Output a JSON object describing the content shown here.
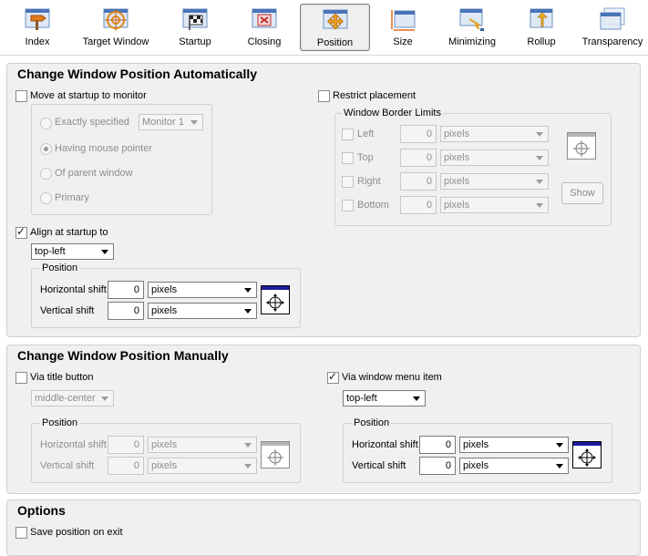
{
  "toolbar": {
    "items": [
      {
        "label": "Index"
      },
      {
        "label": "Target Window"
      },
      {
        "label": "Startup"
      },
      {
        "label": "Closing"
      },
      {
        "label": "Position"
      },
      {
        "label": "Size"
      },
      {
        "label": "Minimizing"
      },
      {
        "label": "Rollup"
      },
      {
        "label": "Transparency"
      }
    ]
  },
  "auto": {
    "title": "Change Window Position Automatically",
    "move_monitor": {
      "label": "Move at startup to monitor",
      "checked": false
    },
    "exactly": {
      "label": "Exactly specified",
      "combo": "Monitor 1"
    },
    "mouse": {
      "label": "Having mouse pointer"
    },
    "parent": {
      "label": "Of parent window"
    },
    "primary": {
      "label": "Primary"
    },
    "align": {
      "label": "Align at startup to",
      "checked": true,
      "value": "top-left"
    },
    "position": {
      "title": "Position",
      "h_label": "Horizontal shift",
      "h_value": "0",
      "h_unit": "pixels",
      "v_label": "Vertical shift",
      "v_value": "0",
      "v_unit": "pixels"
    },
    "restrict": {
      "label": "Restrict placement",
      "checked": false
    },
    "border": {
      "title": "Window Border Limits",
      "rows": [
        {
          "label": "Left",
          "value": "0",
          "unit": "pixels"
        },
        {
          "label": "Top",
          "value": "0",
          "unit": "pixels"
        },
        {
          "label": "Right",
          "value": "0",
          "unit": "pixels"
        },
        {
          "label": "Bottom",
          "value": "0",
          "unit": "pixels"
        }
      ],
      "show_label": "Show"
    }
  },
  "manual": {
    "title": "Change Window Position Manually",
    "title_button": {
      "label": "Via title button",
      "checked": false,
      "value": "middle-center"
    },
    "left_pos": {
      "title": "Position",
      "h_label": "Horizontal shift",
      "h_value": "0",
      "h_unit": "pixels",
      "v_label": "Vertical shift",
      "v_value": "0",
      "v_unit": "pixels"
    },
    "menu_item": {
      "label": "Via window menu item",
      "checked": true,
      "value": "top-left"
    },
    "right_pos": {
      "title": "Position",
      "h_label": "Horizontal shift",
      "h_value": "0",
      "h_unit": "pixels",
      "v_label": "Vertical shift",
      "v_value": "0",
      "v_unit": "pixels"
    }
  },
  "options": {
    "title": "Options",
    "save_pos": {
      "label": "Save position on exit",
      "checked": false
    }
  }
}
